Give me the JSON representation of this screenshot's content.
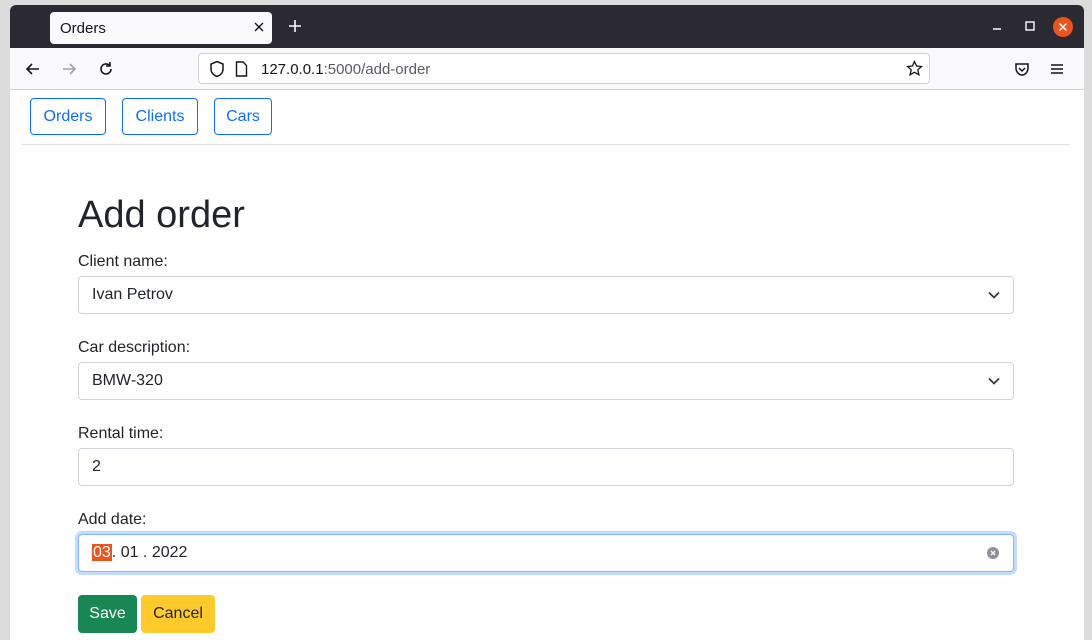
{
  "browser": {
    "tab_title": "Orders",
    "url_host": "127.0.0.1",
    "url_rest": ":5000/add-order"
  },
  "nav": {
    "orders": "Orders",
    "clients": "Clients",
    "cars": "Cars"
  },
  "form": {
    "heading": "Add order",
    "client_label": "Client name:",
    "client_value": "Ivan Petrov",
    "car_label": "Car description:",
    "car_value": "BMW-320",
    "rental_label": "Rental time:",
    "rental_value": "2",
    "date_label": "Add date:",
    "date_day": "03",
    "date_rest": ". 01 . 2022",
    "save_label": "Save",
    "cancel_label": "Cancel"
  },
  "colors": {
    "primary": "#0d6efd",
    "success": "#198754",
    "warning": "#ffca2c",
    "highlight": "#e95420"
  }
}
